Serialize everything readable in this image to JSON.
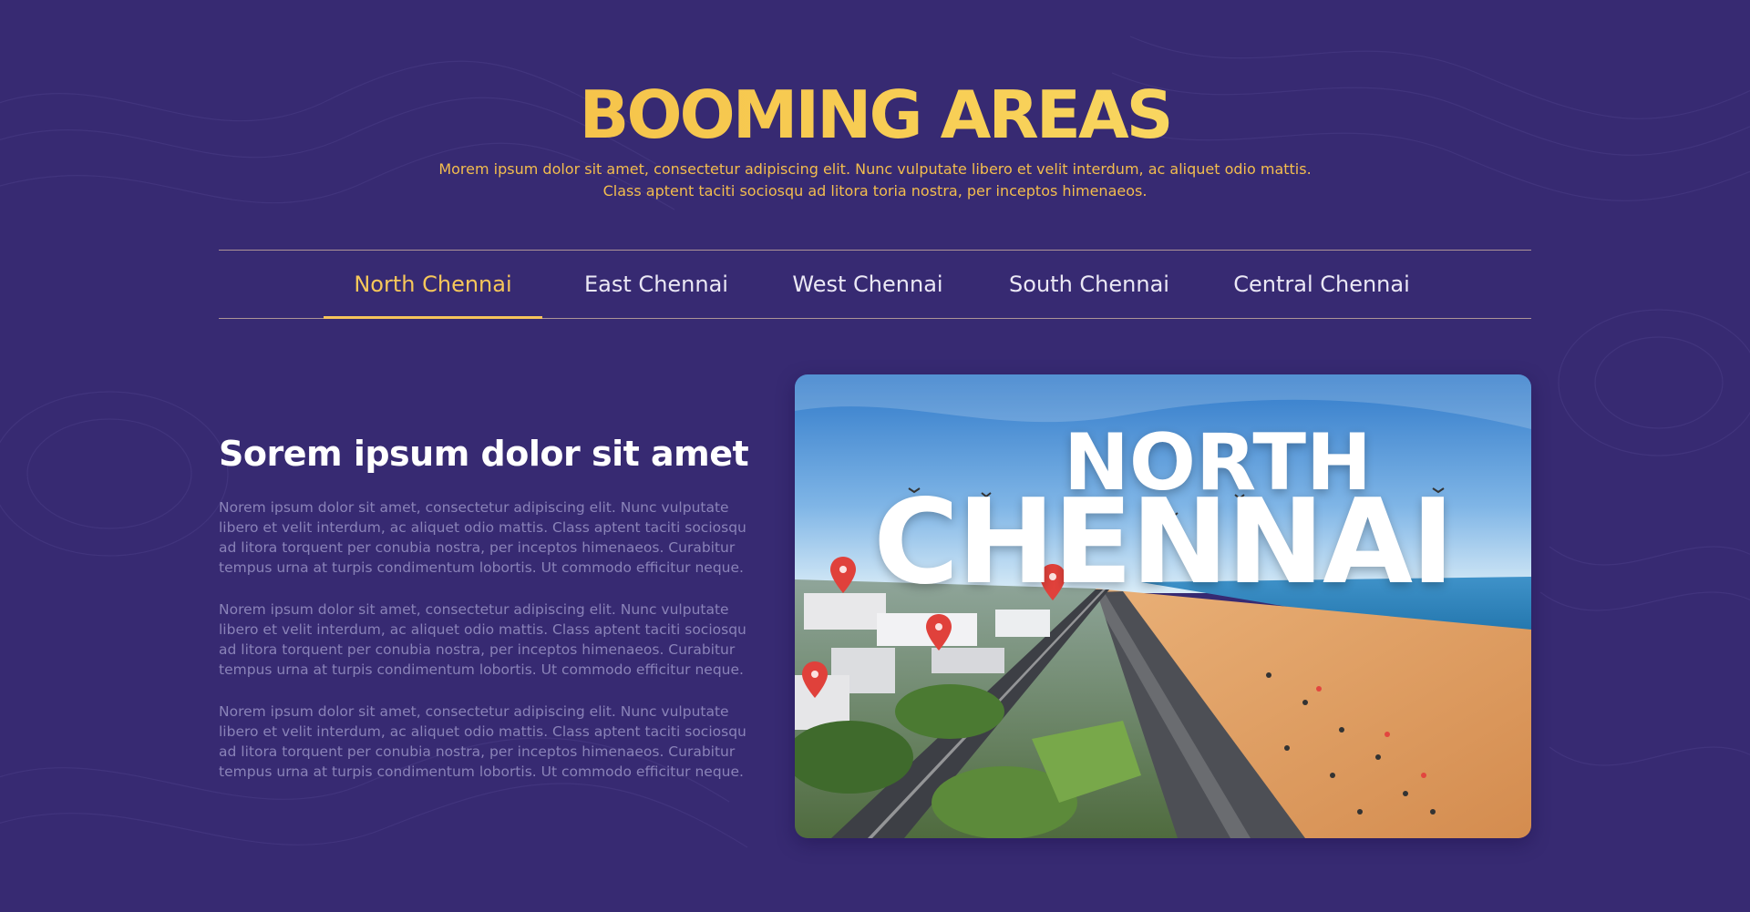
{
  "header": {
    "title": "BOOMING AREAS",
    "subtitle_line1": "Morem ipsum dolor sit amet, consectetur adipiscing elit. Nunc vulputate libero et velit interdum, ac aliquet odio mattis.",
    "subtitle_line2": "Class aptent taciti sociosqu ad litora toria nostra, per inceptos himenaeos."
  },
  "tabs": [
    {
      "label": "North Chennai",
      "active": true
    },
    {
      "label": "East Chennai",
      "active": false
    },
    {
      "label": "West Chennai",
      "active": false
    },
    {
      "label": "South Chennai",
      "active": false
    },
    {
      "label": "Central Chennai",
      "active": false
    }
  ],
  "content": {
    "title": "Sorem ipsum dolor sit amet",
    "paragraphs": [
      "Norem ipsum dolor sit amet, consectetur adipiscing elit. Nunc vulputate libero et velit interdum, ac aliquet odio mattis. Class aptent taciti sociosqu ad litora torquent per conubia nostra, per inceptos himenaeos. Curabitur tempus urna at turpis condimentum lobortis. Ut commodo efficitur neque.",
      "Norem ipsum dolor sit amet, consectetur adipiscing elit. Nunc vulputate libero et velit interdum, ac aliquet odio mattis. Class aptent taciti sociosqu ad litora torquent per conubia nostra, per inceptos himenaeos. Curabitur tempus urna at turpis condimentum lobortis. Ut commodo efficitur neque.",
      "Norem ipsum dolor sit amet, consectetur adipiscing elit. Nunc vulputate libero et velit interdum, ac aliquet odio mattis. Class aptent taciti sociosqu ad litora torquent per conubia nostra, per inceptos himenaeos. Curabitur tempus urna at turpis condimentum lobortis. Ut commodo efficitur neque."
    ]
  },
  "image": {
    "text_line1": "NORTH",
    "text_line2": "CHENNAI"
  },
  "colors": {
    "background": "#372a72",
    "accent": "#f6c45b",
    "body_text": "#8a83b8"
  }
}
